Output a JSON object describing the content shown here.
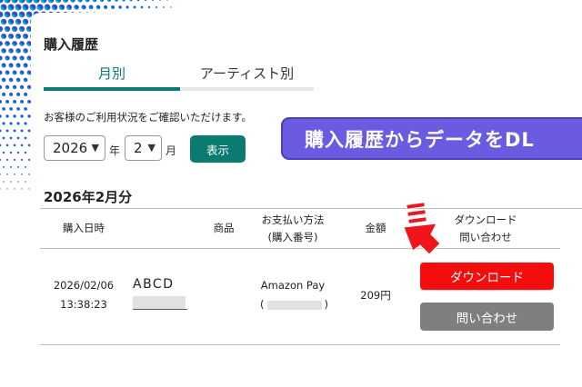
{
  "page": {
    "title": "購入履歴",
    "tabs": [
      {
        "label": "月別",
        "active": true
      },
      {
        "label": "アーティスト別",
        "active": false
      }
    ],
    "notice": "お客様のご利用状況をご確認いただけます。"
  },
  "filter": {
    "year_value": "2026",
    "year_unit": "年",
    "month_value": "2",
    "month_unit": "月",
    "show_label": "表示"
  },
  "banner": {
    "text": "購入履歴からデータをDL"
  },
  "section": {
    "title": "2026年2月分"
  },
  "table": {
    "headers": {
      "date": "購入日時",
      "item": "商品",
      "payment_line1": "お支払い方法",
      "payment_line2": "(購入番号)",
      "amount": "金額",
      "action_line1": "ダウンロード",
      "action_line2": "問い合わせ"
    },
    "rows": [
      {
        "date": "2026/02/06",
        "time": "13:38:23",
        "item": "ABCD",
        "payment": "Amazon Pay",
        "order_prefix": "(",
        "order_suffix": ")",
        "amount": "209円",
        "download_label": "ダウンロード",
        "inquiry_label": "問い合わせ"
      }
    ]
  },
  "colors": {
    "accent": "#0b7a70",
    "download": "#f40d0d",
    "inquiry": "#7f7f7f",
    "banner": "#6a5be0",
    "arrow": "#f0151a"
  }
}
